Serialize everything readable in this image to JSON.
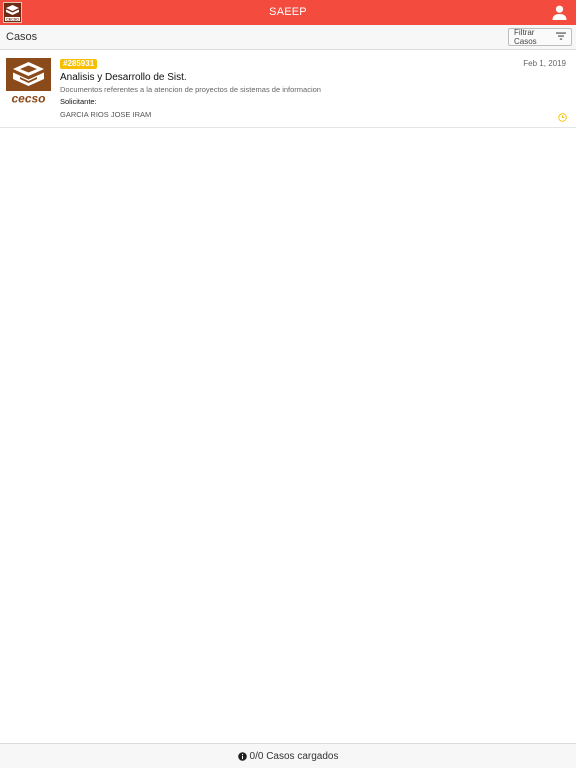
{
  "header": {
    "title": "SAEEP",
    "logo_text": "CECSO",
    "icons": {
      "user": "user-icon"
    },
    "color": "#f44b3f"
  },
  "subheader": {
    "label": "Casos",
    "filter_label": "Filtrar Casos",
    "filter_icon": "filter-lines-icon"
  },
  "cases": [
    {
      "badge": "#285931",
      "date": "Feb 1, 2019",
      "title": "Analisis y Desarrollo de Sist.",
      "description": "Documentos referentes a la atencion de proyectos de sistemas de informacion",
      "requester_label": "Solicitante:",
      "requester_name": "GARCIA RIOS JOSE IRAM",
      "logo_text": "cecso",
      "status_icon": "clock-icon",
      "badge_color": "#f6c000"
    }
  ],
  "footer": {
    "status": "0/0 Casos cargados",
    "icon": "info-circle-icon"
  }
}
